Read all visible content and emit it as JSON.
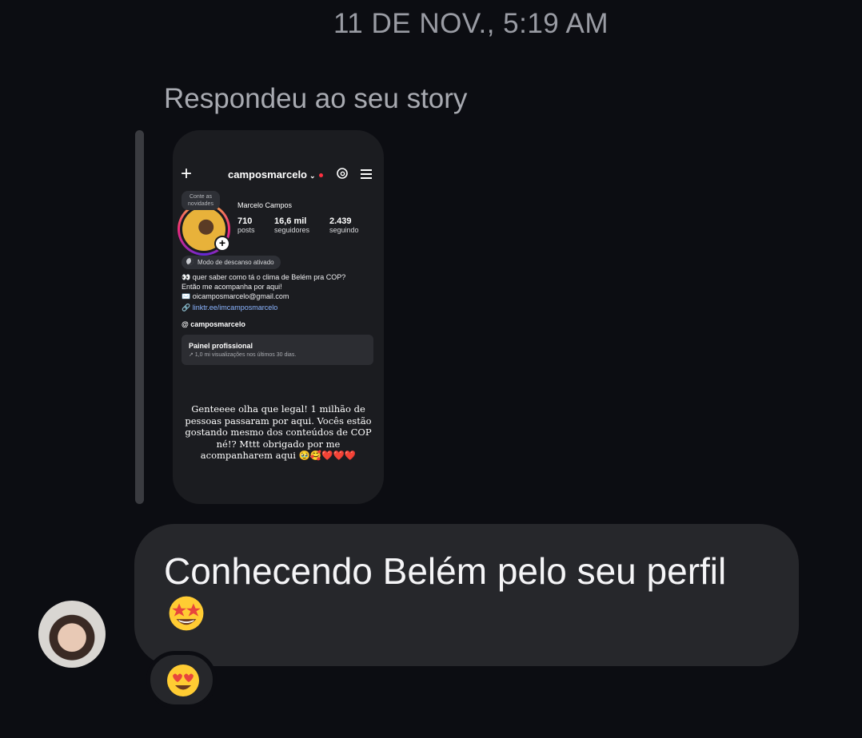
{
  "timestamp": "11 DE NOV., 5:19 AM",
  "reply_note": "Respondeu ao seu story",
  "story": {
    "username": "camposmarcelo",
    "note": "Conte as novidades",
    "display_name": "Marcelo Campos",
    "stats": [
      {
        "value": "710",
        "label": "posts"
      },
      {
        "value": "16,6 mil",
        "label": "seguidores"
      },
      {
        "value": "2.439",
        "label": "seguindo"
      }
    ],
    "rest_mode": "Modo de descanso ativado",
    "bio_lines": [
      "👀 quer saber como tá o clima de Belém pra COP?",
      "Então me acompanha por aqui!",
      "✉️ oicamposmarcelo@gmail.com"
    ],
    "link": "linktr.ee/imcamposmarcelo",
    "threads_handle": "camposmarcelo",
    "panel_title": "Painel profissional",
    "panel_subtitle": "↗ 1,0 mi visualizações nos últimos 30 dias.",
    "caption": "Genteeee olha que legal! 1 milhão de pessoas passaram por aqui. Vocês estão gostando mesmo dos conteúdos de COP né!? Mttt obrigado por me acompanharem aqui 🥹🥰❤️❤️❤️"
  },
  "message": {
    "text": "Conhecendo Belém pelo seu perfil",
    "emoji": "star-struck-emoji"
  },
  "reaction": {
    "emoji": "heart-eyes-emoji"
  }
}
